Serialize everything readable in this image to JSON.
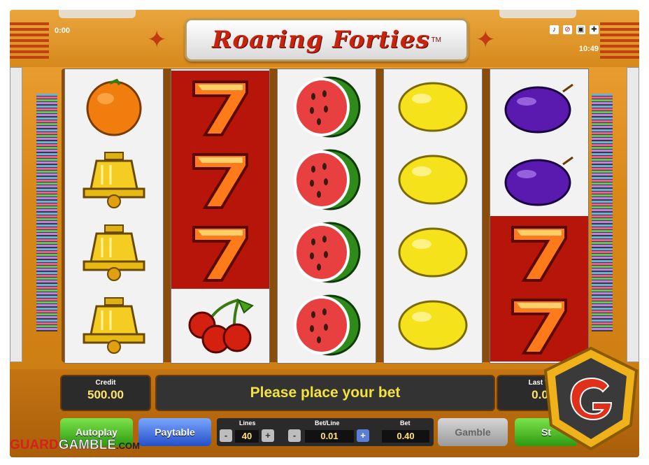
{
  "game": {
    "title": "Roaring Forties",
    "trademark": "TM",
    "timer_left": "0:00",
    "clock": "10:49"
  },
  "status_icons": [
    "music-icon",
    "sound-icon",
    "fullscreen-icon",
    "settings-icon"
  ],
  "reels": [
    [
      "orange",
      "bell",
      "bell",
      "bell"
    ],
    [
      "seven",
      "seven",
      "seven",
      "cherries"
    ],
    [
      "watermelon",
      "watermelon",
      "watermelon",
      "watermelon"
    ],
    [
      "lemon",
      "lemon",
      "lemon",
      "lemon"
    ],
    [
      "plum",
      "plum",
      "seven",
      "seven"
    ]
  ],
  "panel": {
    "credit_label": "Credit",
    "credit_value": "500.00",
    "message": "Please place your bet",
    "last_win_label": "Last W",
    "last_win_value": "0.0"
  },
  "controls": {
    "autoplay": "Autoplay",
    "paytable": "Paytable",
    "lines_label": "Lines",
    "lines_value": "40",
    "betline_label": "Bet/Line",
    "betline_value": "0.01",
    "bet_label": "Bet",
    "bet_value": "0.40",
    "minus": "-",
    "plus": "+",
    "gamble": "Gamble",
    "start": "St"
  },
  "watermark": {
    "part1": "GUARD",
    "part2": "GAMBLE",
    "part3": ".COM"
  },
  "colors": {
    "frame_orange": "#d98918",
    "seven_reel_red": "#b8150a",
    "message_yellow": "#f3e33a"
  }
}
